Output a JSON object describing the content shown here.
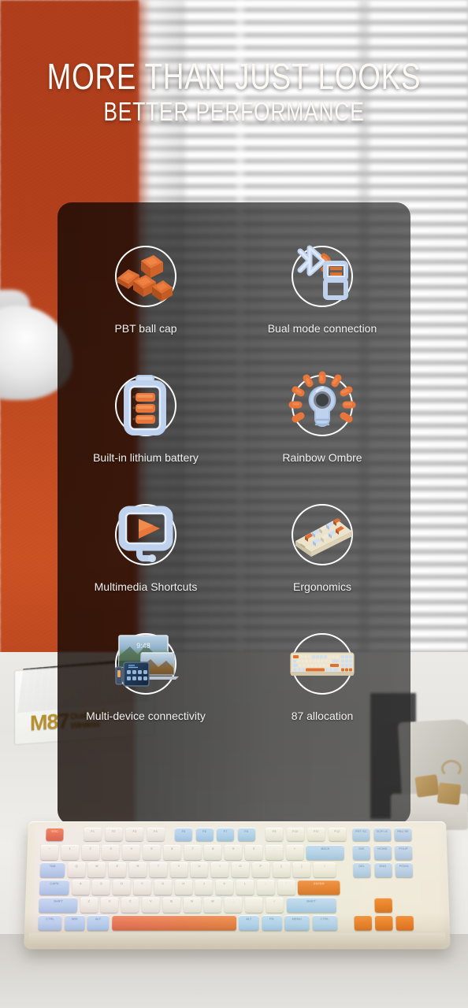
{
  "headline": {
    "line1": "MORE THAN JUST LOOKS",
    "line2": "BETTER PERFORMANCE"
  },
  "features": [
    {
      "label": "PBT ball cap",
      "icon": "keycaps-icon"
    },
    {
      "label": "Bual mode connection",
      "icon": "bluetooth-usb-icon"
    },
    {
      "label": "Built-in lithium battery",
      "icon": "battery-icon"
    },
    {
      "label": "Rainbow Ombre",
      "icon": "lightbulb-icon"
    },
    {
      "label": "Multimedia Shortcuts",
      "icon": "monitor-play-icon"
    },
    {
      "label": "Ergonomics",
      "icon": "angled-keyboard-icon"
    },
    {
      "label": "Multi-device connectivity",
      "icon": "multi-device-icon"
    },
    {
      "label": "87 allocation",
      "icon": "keyboard-layout-icon"
    }
  ],
  "product_box": {
    "model": "M87",
    "subtitle_line1": "Dual mode",
    "subtitle_line2": "Wireless"
  },
  "keyboard": {
    "row_fn": [
      "ESC",
      "F1",
      "F2",
      "F3",
      "F4",
      "F5",
      "F6",
      "F7",
      "F8",
      "F9",
      "F10",
      "F11",
      "F12",
      "PRT SC",
      "SCR LK",
      "PAU SE"
    ],
    "row_num": [
      "~",
      "1",
      "2",
      "3",
      "4",
      "5",
      "6",
      "7",
      "8",
      "9",
      "0",
      "-",
      "+",
      "BACK",
      "INS",
      "HOME",
      "PGUP"
    ],
    "row_q": [
      "TAB",
      "Q",
      "W",
      "E",
      "R",
      "T",
      "Y",
      "U",
      "I",
      "O",
      "P",
      "[",
      "]",
      "\\",
      "DEL",
      "END",
      "PGDN"
    ],
    "row_a": [
      "CAPS",
      "A",
      "S",
      "D",
      "F",
      "G",
      "H",
      "J",
      "K",
      "L",
      ";",
      "'",
      "ENTER"
    ],
    "row_z": [
      "SHIFT",
      "Z",
      "X",
      "C",
      "V",
      "B",
      "N",
      "M",
      ",",
      ".",
      "/",
      "SHIFT"
    ],
    "row_ctl": [
      "CTRL",
      "WIN",
      "ALT",
      "",
      "ALT",
      "FN",
      "MENU",
      "CTRL"
    ],
    "arrows": [
      "UP",
      "LEFT",
      "DOWN",
      "RIGHT"
    ]
  },
  "colors": {
    "accent_orange": "#e3681f",
    "wall_orange": "#b53c17",
    "key_blue": "#afc8e4",
    "key_cream": "#ece6d7",
    "card_overlay": "#1a1a1a",
    "text_white": "#f2f2f2",
    "box_gold": "#b8912f"
  }
}
